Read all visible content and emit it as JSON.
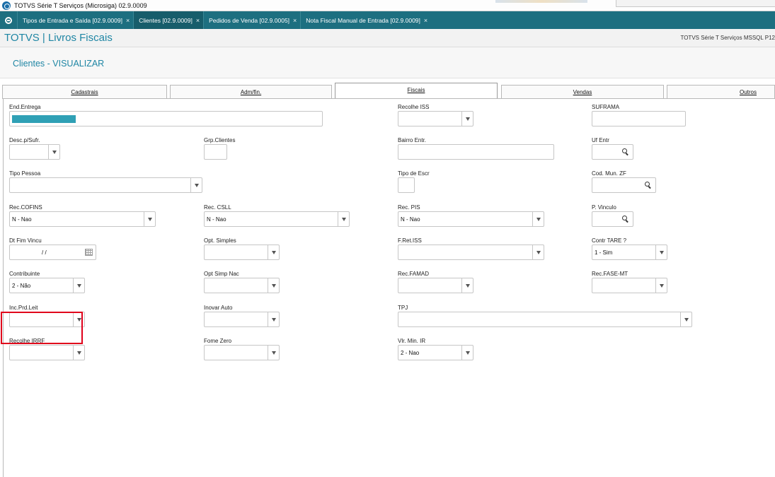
{
  "window": {
    "title": "TOTVS Série T Serviços (Microsiga) 02.9.0009"
  },
  "app_tabs": [
    {
      "label": "Tipos de Entrada e Saída [02.9.0009]"
    },
    {
      "label": "Clientes [02.9.0009]"
    },
    {
      "label": "Pedidos de Venda [02.9.0005]"
    },
    {
      "label": "Nota Fiscal Manual de Entrada [02.9.0009]"
    }
  ],
  "module": {
    "title": "TOTVS | Livros Fiscais",
    "env": "TOTVS Série T Serviços MSSQL P12"
  },
  "page": {
    "title": "Clientes - VISUALIZAR"
  },
  "folders": [
    {
      "label": "Cadastrais"
    },
    {
      "label": "Adm/fin."
    },
    {
      "label": "Fiscais"
    },
    {
      "label": "Vendas"
    },
    {
      "label": "Outros"
    }
  ],
  "active_folder": "Fiscais",
  "accent_color": "#1f86a4",
  "fields": {
    "end_entrega": {
      "label": "End.Entrega",
      "value": ""
    },
    "recolhe_iss": {
      "label": "Recolhe ISS",
      "value": ""
    },
    "suframa": {
      "label": "SUFRAMA",
      "value": ""
    },
    "desc_sufr": {
      "label": "Desc.p/Sufr.",
      "value": ""
    },
    "grp_clientes": {
      "label": "Grp.Clientes",
      "value": ""
    },
    "bairro_entr": {
      "label": "Bairro Entr.",
      "value": ""
    },
    "uf_entr": {
      "label": "Uf Entr",
      "value": ""
    },
    "tipo_pessoa": {
      "label": "Tipo Pessoa",
      "value": ""
    },
    "tipo_escr": {
      "label": "Tipo de Escr",
      "value": ""
    },
    "cod_mun_zf": {
      "label": "Cod. Mun. ZF",
      "value": ""
    },
    "rec_cofins": {
      "label": "Rec.COFINS",
      "value": "N - Nao"
    },
    "rec_csll": {
      "label": "Rec. CSLL",
      "value": "N - Nao"
    },
    "rec_pis": {
      "label": "Rec. PIS",
      "value": "N - Nao"
    },
    "p_vinculo": {
      "label": "P. Vinculo",
      "value": ""
    },
    "dt_fim_vincu": {
      "label": "Dt Fim Vincu",
      "value": "/ /"
    },
    "opt_simples": {
      "label": "Opt. Simples",
      "value": ""
    },
    "f_ret_iss": {
      "label": "F.Ret.ISS",
      "value": ""
    },
    "contr_tare": {
      "label": "Contr TARE ?",
      "value": "1 - Sim"
    },
    "contribuinte": {
      "label": "Contribuinte",
      "value": "2 - Não"
    },
    "opt_simp_nac": {
      "label": "Opt Simp Nac",
      "value": ""
    },
    "rec_famad": {
      "label": "Rec.FAMAD",
      "value": ""
    },
    "rec_fase_mt": {
      "label": "Rec.FASE-MT",
      "value": ""
    },
    "inc_prd_leit": {
      "label": "Inc.Prd.Leit",
      "value": ""
    },
    "inovar_auto": {
      "label": "Inovar Auto",
      "value": ""
    },
    "tpj": {
      "label": "TPJ",
      "value": ""
    },
    "recolhe_irrf": {
      "label": "Recolhe IRRF",
      "value": ""
    },
    "fome_zero": {
      "label": "Fome Zero",
      "value": ""
    },
    "vlr_min_ir": {
      "label": "Vlr. Min. IR",
      "value": "2 - Nao"
    }
  }
}
